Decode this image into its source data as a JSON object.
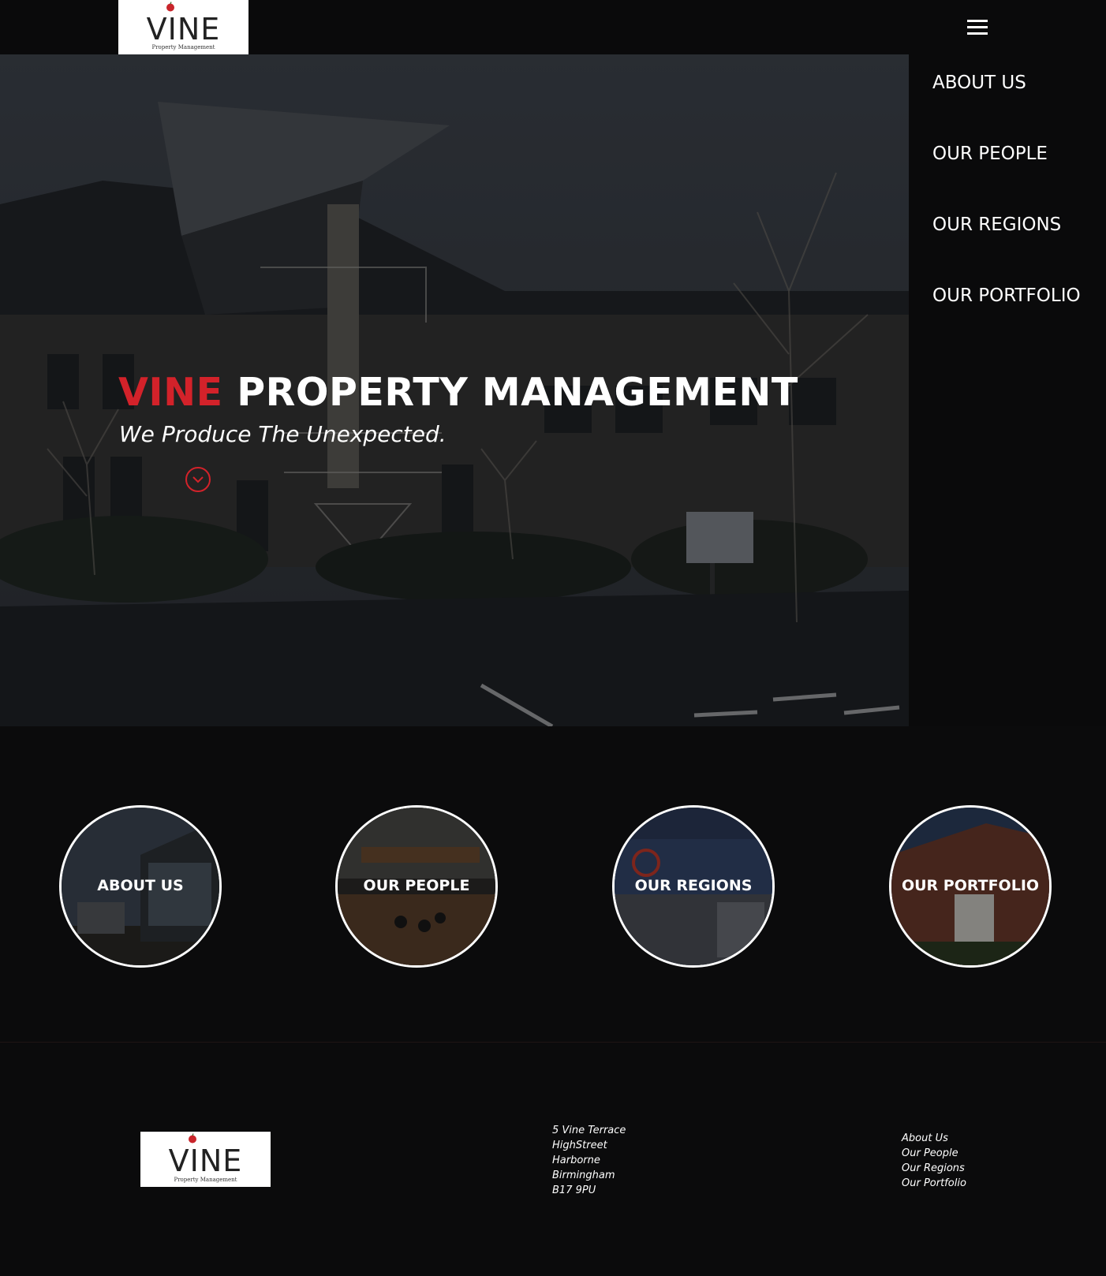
{
  "header": {
    "logo_text": "VINE",
    "logo_sub": "Property Management",
    "menu_icon": "hamburger-menu-icon"
  },
  "nav": {
    "items": [
      {
        "label": "ABOUT US"
      },
      {
        "label": "OUR PEOPLE"
      },
      {
        "label": "OUR REGIONS"
      },
      {
        "label": "OUR PORTFOLIO"
      }
    ]
  },
  "hero": {
    "title_accent": "VINE",
    "title_rest": "PROPERTY MANAGEMENT",
    "tagline": "We Produce The Unexpected.",
    "scroll_icon": "chevron-down-circle-icon",
    "accent_color": "#d3222a"
  },
  "cards": [
    {
      "label": "ABOUT US"
    },
    {
      "label": "OUR PEOPLE"
    },
    {
      "label": "OUR REGIONS"
    },
    {
      "label": "OUR PORTFOLIO"
    }
  ],
  "footer": {
    "logo_text": "VINE",
    "logo_sub": "Property Management",
    "address": [
      "5 Vine Terrace",
      "HighStreet",
      "Harborne",
      "Birmingham",
      "B17 9PU"
    ],
    "links": [
      "About Us",
      "Our People",
      "Our Regions",
      "Our Portfolio"
    ]
  }
}
